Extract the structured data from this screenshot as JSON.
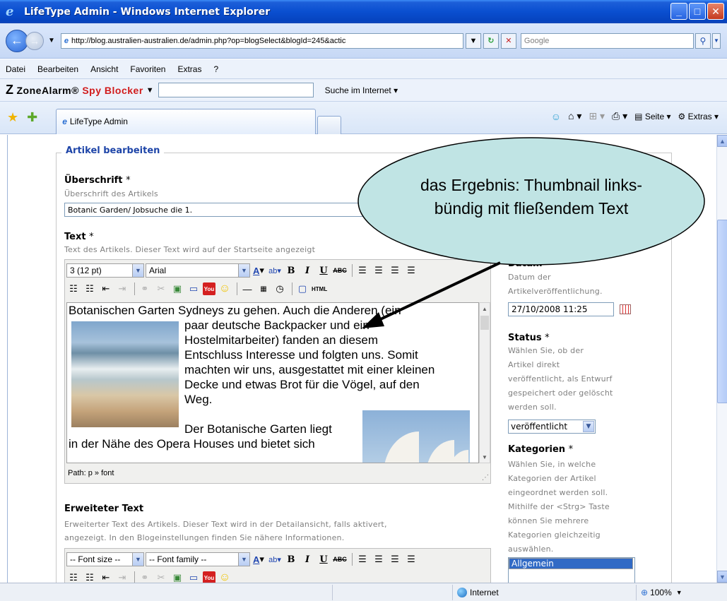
{
  "window": {
    "title": "LifeType Admin - Windows Internet Explorer",
    "icon": "ie-icon",
    "controls": [
      "minimize",
      "maximize",
      "close"
    ]
  },
  "address_bar": {
    "url": "http://blog.australien-australien.de/admin.php?op=blogSelect&blogId=245&actic",
    "search_placeholder": "Google"
  },
  "menu": {
    "items": [
      "Datei",
      "Bearbeiten",
      "Ansicht",
      "Favoriten",
      "Extras",
      "?"
    ]
  },
  "zonealarm": {
    "logo_part1": "ZoneAlarm",
    "logo_part2": "Spy Blocker",
    "search_label": "Suche im Internet"
  },
  "tabs": {
    "active_tab": "LifeType Admin",
    "commands": {
      "page": "Seite",
      "extras": "Extras"
    }
  },
  "form": {
    "section_legend": "Artikel bearbeiten",
    "title_field": {
      "label": "Überschrift",
      "required_marker": "*",
      "hint": "Überschrift des Artikels",
      "value": "Botanic Garden/ Jobsuche die 1."
    },
    "text_field": {
      "label": "Text",
      "required_marker": "*",
      "hint": "Text des Artikels. Dieser Text wird auf der Startseite angezeigt",
      "font_size": "3 (12 pt)",
      "font_family": "Arial",
      "content_lines": [
        "Botanischen Garten Sydneys zu gehen. Auch die Anderen (ein",
        "paar deutsche Backpacker und ein",
        "Hostelmitarbeiter) fanden an diesem",
        "Entschluss Interesse und folgten uns. Somit",
        "machten wir uns, ausgestattet mit einer kleinen",
        "Decke und etwas Brot für die Vögel, auf den",
        "Weg.",
        "Der Botanische Garten liegt",
        "in der Nähe des Opera Houses und bietet sich"
      ],
      "path": "Path: p » font"
    },
    "extended_text_field": {
      "label": "Erweiteter Text",
      "hint_line1": "Erweiterter Text des Artikels. Dieser Text wird in der Detailansicht, falls aktivert,",
      "hint_line2": "angezeigt. In den Blogeinstellungen finden Sie nähere Informationen.",
      "font_size": "-- Font size --",
      "font_family": "-- Font family --"
    },
    "date_field": {
      "label": "Datum",
      "required_marker": "*",
      "hint_line1": "Datum der",
      "hint_line2": "Artikelveröffentlichung.",
      "value": "27/10/2008 11:25"
    },
    "status_field": {
      "label": "Status",
      "required_marker": "*",
      "hint_lines": [
        "Wählen Sie, ob der",
        "Artikel direkt",
        "veröffentlicht, als Entwurf",
        "gespeichert oder gelöscht",
        "werden soll."
      ],
      "value": "veröffentlicht"
    },
    "categories_field": {
      "label": "Kategorien",
      "required_marker": "*",
      "hint_lines": [
        "Wählen Sie, in welche",
        "Kategorien der Artikel",
        "eingeordnet werden soll.",
        "Mithilfe der <Strg> Taste",
        "können Sie mehrere",
        "Kategorien gleichzeitig",
        "auswählen."
      ],
      "selected": "Allgemein"
    }
  },
  "callout": {
    "line1": "das Ergebnis: Thumbnail links-",
    "line2": "bündig mit fließendem Text",
    "fill_color": "#c0e4e4"
  },
  "status_bar": {
    "zone": "Internet",
    "zoom": "100%"
  }
}
